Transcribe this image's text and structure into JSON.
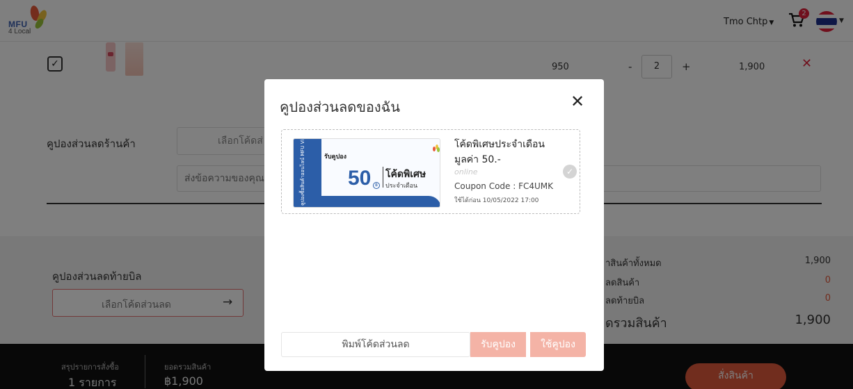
{
  "header": {
    "logo_line1": "MFU",
    "logo_line2": "4 Local",
    "user_name": "Tmo Chtp",
    "cart_count": "2"
  },
  "cart_item": {
    "checked": "✓",
    "price": "950",
    "qty_minus": "-",
    "quantity": "2",
    "qty_plus": "+",
    "line_total": "1,900",
    "remove_icon": "✕"
  },
  "shop_coupon": {
    "label": "คูปองส่วนลดร้านค้า",
    "button": "เลือกโค้ดส่",
    "message_placeholder": "ส่งข้อความของคุณ"
  },
  "bill_coupon": {
    "label": "คูปองส่วนลดท้ายบิล",
    "button": "เลือกโค้ดส่วนลด",
    "arrow": "→"
  },
  "summary": {
    "rows": [
      {
        "label": "าสินค้าทั้งหมด",
        "value": "1,900"
      },
      {
        "label": "ลดสินค้า",
        "value": "0"
      },
      {
        "label": "ลดท้ายบิล",
        "value": "0"
      }
    ],
    "total_label": "ดรวมสินค้า",
    "total_value": "1,900",
    "accent_color": "#e25a3c"
  },
  "footer": {
    "summary_label": "สรุปรายการสั่งซื้อ",
    "summary_value": "1 รายการ",
    "total_label": "ยอดรวมสินค้า",
    "total_value": "฿1,900",
    "order_button": "สั่งสินค้า"
  },
  "modal": {
    "title": "คูปองส่วนลดของฉัน",
    "close_icon": "✕",
    "coupon": {
      "ticket_vertical_text": "คูปองซื้อสินค้าออนไลน์ MFU Virtual Store",
      "ticket_receive": "รับคูปอง",
      "ticket_amount": "50",
      "ticket_currency": "฿",
      "ticket_special": "โค้ดพิเศษ",
      "ticket_month": "ประจำเดือน",
      "title": "โค้ดพิเศษประจำเดือน",
      "value": "มูลค่า 50.-",
      "channel": "online",
      "code": "Coupon Code : FC4UMK",
      "expire": "ใช้ได้ก่อน 10/05/2022 17:00",
      "check_icon": "✓"
    },
    "code_placeholder": "พิมพ์โค้ดส่วนลด",
    "receive_button": "รับคูปอง",
    "use_button": "ใช้คูปอง",
    "button_color": "#f4b3a6"
  }
}
